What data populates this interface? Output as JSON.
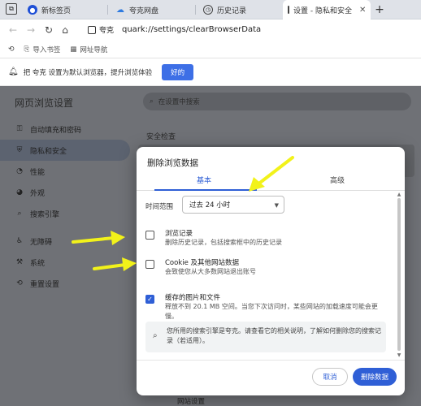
{
  "tabs": [
    {
      "title": "新标签页",
      "icon": "quark-icon"
    },
    {
      "title": "夸克网盘",
      "icon": "cloud-icon"
    },
    {
      "title": "历史记录",
      "icon": "history-icon"
    },
    {
      "title": "设置 - 隐私和安全",
      "icon": "settings-icon",
      "active": true
    }
  ],
  "toolbar": {
    "site_name": "夸克",
    "url": "quark://settings/clearBrowserData"
  },
  "bookmarks": [
    {
      "label": "导入书签",
      "icon": "import-icon"
    },
    {
      "label": "网址导航",
      "icon": "grid-icon"
    }
  ],
  "infobar": {
    "message": "把 夸克 设置为默认浏览器，提升浏览体验",
    "button": "好的"
  },
  "settings": {
    "title": "网页浏览设置",
    "search_placeholder": "在设置中搜索",
    "section_title": "安全检查",
    "bottom_text": "网站设置",
    "nav": [
      {
        "label": "自动填充和密码",
        "icon": "key-icon"
      },
      {
        "label": "隐私和安全",
        "icon": "shield-icon",
        "active": true
      },
      {
        "label": "性能",
        "icon": "speed-icon"
      },
      {
        "label": "外观",
        "icon": "palette-icon"
      },
      {
        "label": "搜索引擎",
        "icon": "search-icon"
      },
      {
        "label": "无障碍",
        "icon": "accessibility-icon"
      },
      {
        "label": "系统",
        "icon": "wrench-icon"
      },
      {
        "label": "重置设置",
        "icon": "reset-icon"
      }
    ]
  },
  "dialog": {
    "title": "删除浏览数据",
    "tab_basic": "基本",
    "tab_advanced": "高级",
    "time_label": "时间范围",
    "time_value": "过去 24 小时",
    "options": [
      {
        "title": "浏览记录",
        "desc": "删除历史记录，包括搜索框中的历史记录",
        "checked": false
      },
      {
        "title": "Cookie 及其他网站数据",
        "desc": "会致使您从大多数网站退出账号",
        "checked": false
      },
      {
        "title": "缓存的图片和文件",
        "desc": "释放不到 20.1 MB 空间。当您下次访问时，某些网站的加载速度可能会更慢。",
        "checked": true
      }
    ],
    "notice": "您所用的搜索引擎是夸克。请查看它的相关说明，了解如何删除您的搜索记录（若适用）。",
    "cancel": "取消",
    "delete": "删除数据"
  },
  "colors": {
    "accent": "#2f5fd6",
    "arrow": "#f2f21a",
    "overlay": "#6f7176"
  }
}
